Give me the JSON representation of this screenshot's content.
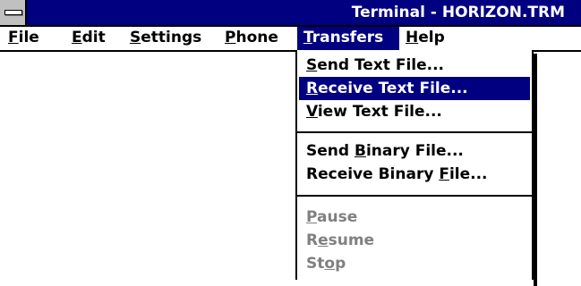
{
  "window": {
    "title": "Terminal - HORIZON.TRM"
  },
  "menubar": {
    "items": [
      {
        "pre": "",
        "mn": "F",
        "post": "ile"
      },
      {
        "pre": "",
        "mn": "E",
        "post": "dit"
      },
      {
        "pre": "",
        "mn": "S",
        "post": "ettings"
      },
      {
        "pre": "",
        "mn": "P",
        "post": "hone"
      },
      {
        "pre": "",
        "mn": "T",
        "post": "ransfers"
      },
      {
        "pre": "",
        "mn": "H",
        "post": "elp"
      }
    ]
  },
  "transfers_menu": {
    "items": [
      {
        "pre": "",
        "mn": "S",
        "post": "end Text File...",
        "enabled": true
      },
      {
        "pre": "",
        "mn": "R",
        "post": "eceive Text File...",
        "enabled": true,
        "highlighted": true
      },
      {
        "pre": "",
        "mn": "V",
        "post": "iew Text File...",
        "enabled": true
      },
      {
        "pre": "Send ",
        "mn": "B",
        "post": "inary File...",
        "enabled": true
      },
      {
        "pre": "Receive Binary ",
        "mn": "F",
        "post": "ile...",
        "enabled": true
      },
      {
        "pre": "",
        "mn": "P",
        "post": "ause",
        "enabled": false
      },
      {
        "pre": "R",
        "mn": "e",
        "post": "sume",
        "enabled": false
      },
      {
        "pre": "St",
        "mn": "o",
        "post": "p",
        "enabled": false
      }
    ]
  },
  "colors": {
    "titlebar": "#000080",
    "highlight": "#000080",
    "disabled_text": "#808080"
  },
  "icons": {
    "system_menu": "system-menu-icon"
  }
}
